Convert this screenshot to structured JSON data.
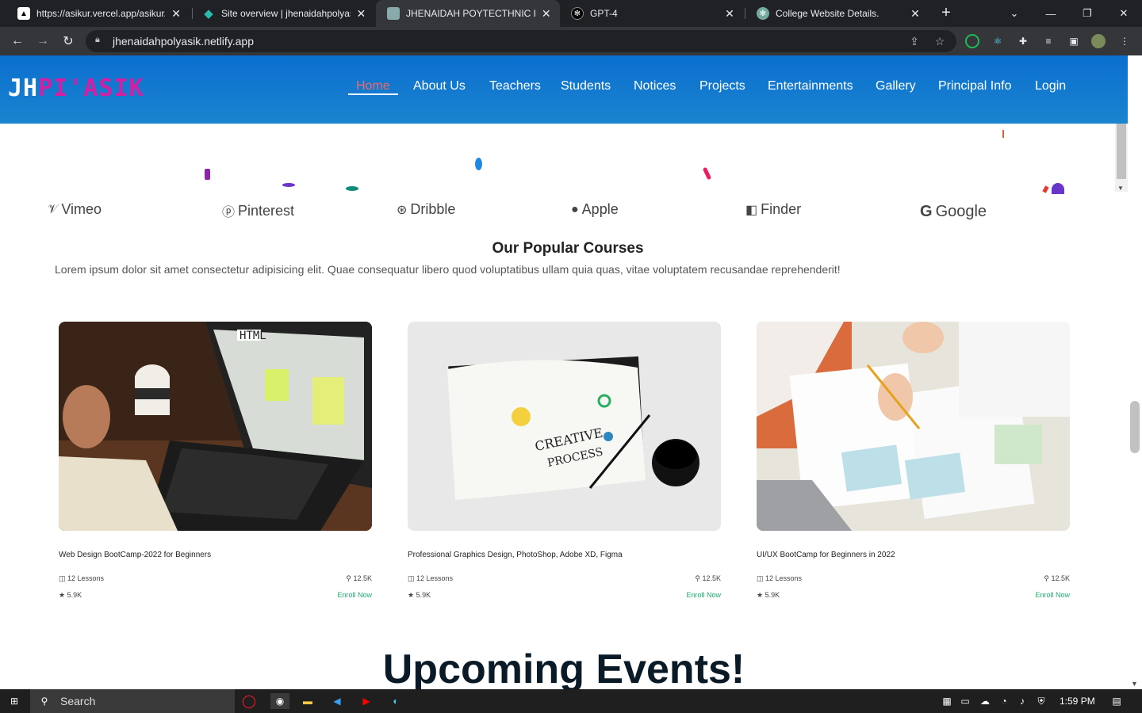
{
  "browser": {
    "tabs": [
      {
        "title": "https://asikur.vercel.app/asikur/",
        "favicon": "vercel-icon"
      },
      {
        "title": "Site overview | jhenaidahpolyasi",
        "favicon": "netlify-icon"
      },
      {
        "title": "JHENAIDAH POYTECTHNIC INS",
        "favicon": "site-icon"
      },
      {
        "title": "GPT-4",
        "favicon": "openai-icon"
      },
      {
        "title": "College Website Details.",
        "favicon": "chatgpt-icon"
      }
    ],
    "url": "jhenaidahpolyasik.netlify.app"
  },
  "site": {
    "logo_part1": "JH",
    "logo_part2": "PI'ASIK",
    "nav": [
      "Home",
      "About Us",
      "Teachers",
      "Students",
      "Notices",
      "Projects",
      "Entertainments",
      "Gallery",
      "Principal Info",
      "Login"
    ],
    "active_nav": "Home"
  },
  "brands": [
    {
      "name": "Vimeo",
      "icon": "vimeo-icon"
    },
    {
      "name": "Pinterest",
      "icon": "pinterest-icon"
    },
    {
      "name": "Dribble",
      "icon": "dribbble-icon"
    },
    {
      "name": "Apple",
      "icon": "apple-icon"
    },
    {
      "name": "Finder",
      "icon": "finder-icon"
    },
    {
      "name": "Google",
      "icon": "google-icon"
    }
  ],
  "courses": {
    "title": "Our Popular Courses",
    "description": "Lorem ipsum dolor sit amet consectetur adipisicing elit. Quae consequatur libero quod voluptatibus ullam quia quas, vitae voluptatem recusandae reprehenderit!",
    "items": [
      {
        "title": "Web Design BootCamp-2022 for Beginners",
        "lessons": "12 Lessons",
        "students": "12.5K",
        "rating": "5.9K",
        "cta": "Enroll Now"
      },
      {
        "title": "Professional Graphics Design, PhotoShop, Adobe XD, Figma",
        "lessons": "12 Lessons",
        "students": "12.5K",
        "rating": "5.9K",
        "cta": "Enroll Now"
      },
      {
        "title": "UI/UX BootCamp for Beginners in 2022",
        "lessons": "12 Lessons",
        "students": "12.5K",
        "rating": "5.9K",
        "cta": "Enroll Now"
      }
    ]
  },
  "events": {
    "title": "Upcoming Events!"
  },
  "taskbar": {
    "search_label": "Search",
    "time": "1:59 PM"
  },
  "colors": {
    "header_blue": "#0b6fcf",
    "logo_pink": "#d21fa3",
    "active_nav": "#f26a6a",
    "enroll_green": "#1ab06b"
  }
}
